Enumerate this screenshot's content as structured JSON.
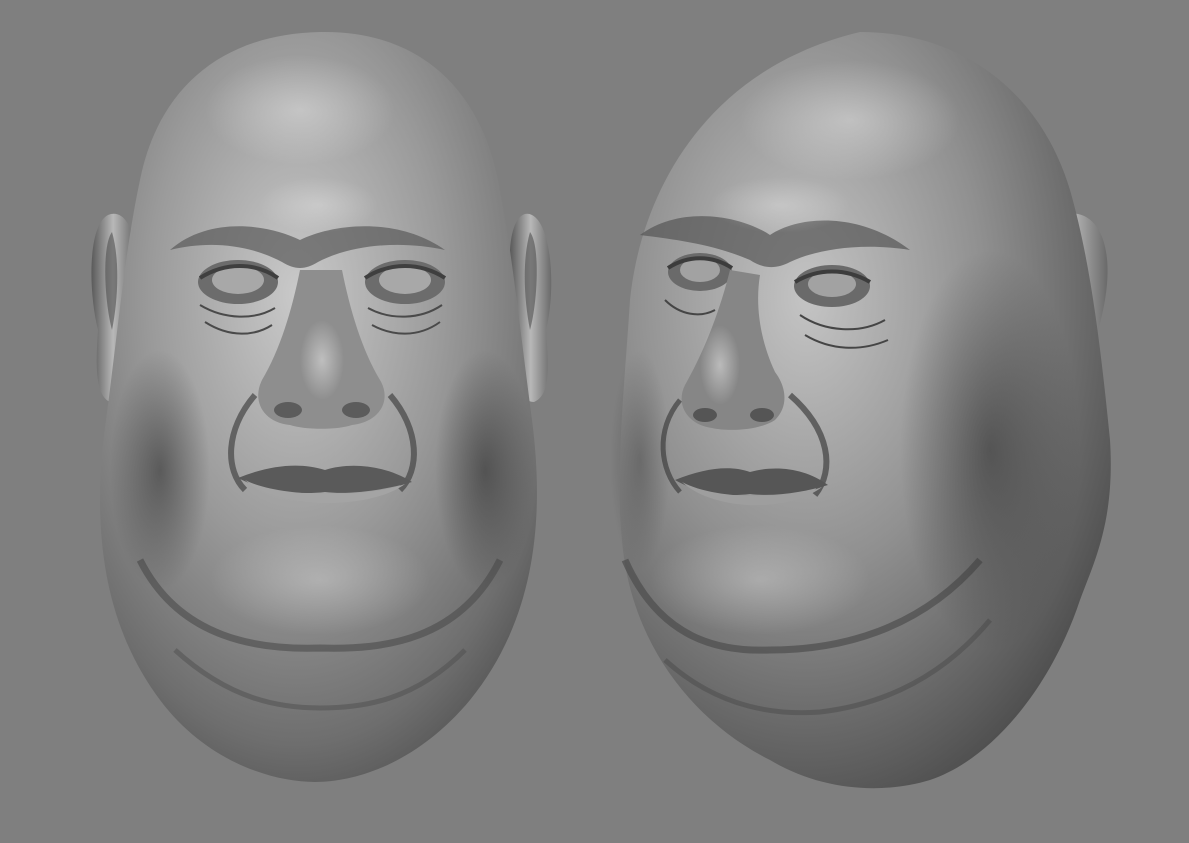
{
  "scene": {
    "background_color": "#7f7f7f",
    "material_base_color": "#8a8a8a",
    "material_highlight_color": "#d2d2d2",
    "material_shadow_color": "#3a3a3a",
    "views": [
      {
        "name": "front-view"
      },
      {
        "name": "three-quarter-view"
      }
    ]
  }
}
